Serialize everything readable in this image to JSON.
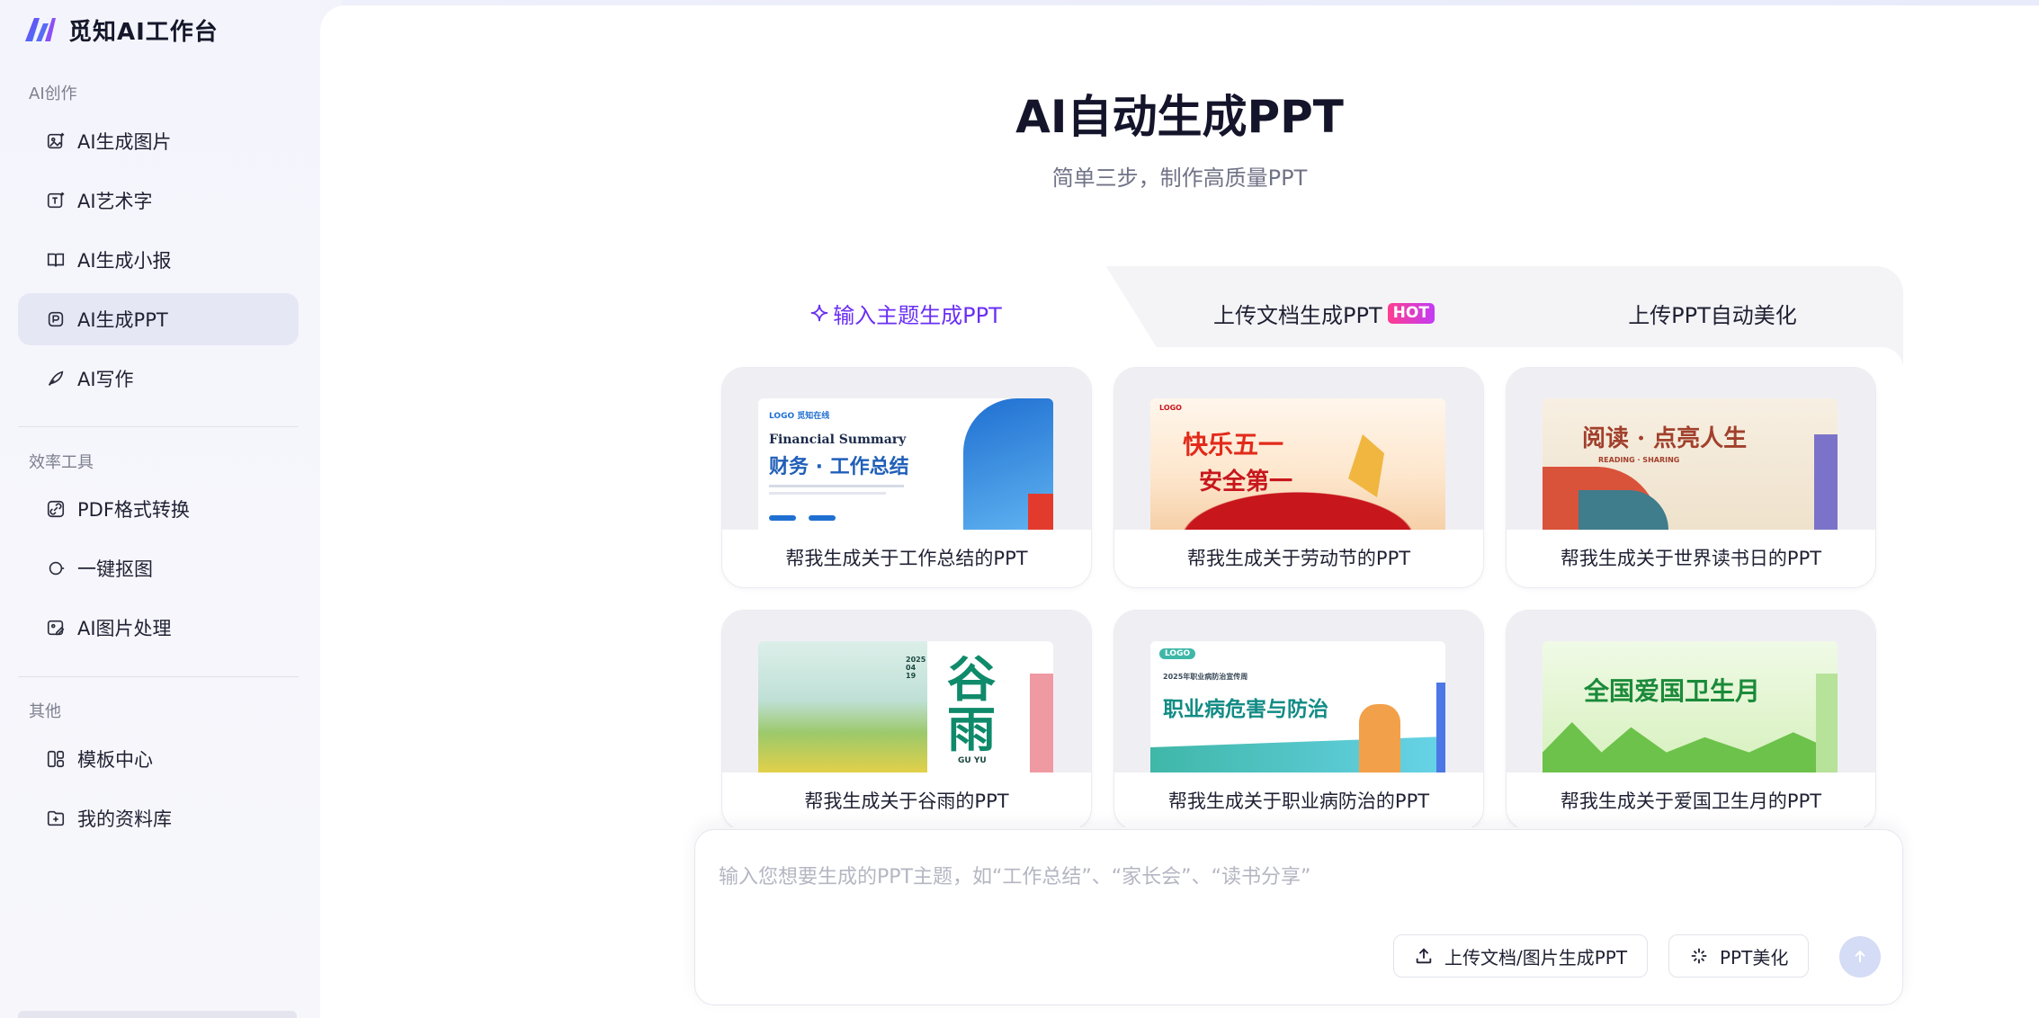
{
  "brand": {
    "name": "觅知AI工作台"
  },
  "sidebar": {
    "sections": [
      {
        "title": "AI创作"
      },
      {
        "title": "效率工具"
      },
      {
        "title": "其他"
      }
    ],
    "items": [
      {
        "label": "AI生成图片",
        "icon": "image-sparkle-icon"
      },
      {
        "label": "AI艺术字",
        "icon": "text-sparkle-icon"
      },
      {
        "label": "AI生成小报",
        "icon": "book-icon"
      },
      {
        "label": "AI生成PPT",
        "icon": "ppt-icon",
        "active": true
      },
      {
        "label": "AI写作",
        "icon": "quill-icon"
      },
      {
        "label": "PDF格式转换",
        "icon": "link-convert-icon"
      },
      {
        "label": "一键抠图",
        "icon": "cutout-icon"
      },
      {
        "label": "AI图片处理",
        "icon": "image-edit-icon"
      },
      {
        "label": "模板中心",
        "icon": "template-icon"
      },
      {
        "label": "我的资料库",
        "icon": "folder-icon"
      }
    ]
  },
  "main": {
    "title": "AI自动生成PPT",
    "subtitle": "简单三步，制作高质量PPT",
    "tabs": [
      {
        "label": "输入主题生成PPT",
        "active": true
      },
      {
        "label": "上传文档生成PPT",
        "badge": "HOT"
      },
      {
        "label": "上传PPT自动美化"
      }
    ],
    "templates": [
      {
        "caption": "帮我生成关于工作总结的PPT",
        "thumb_title": "财务 · 工作总结",
        "thumb_sub": "Financial Summary",
        "thumb_logo": "LOGO 觅知在线"
      },
      {
        "caption": "帮我生成关于劳动节的PPT",
        "thumb_title": "快乐五一",
        "thumb_sub": "安全第一",
        "thumb_logo": "LOGO"
      },
      {
        "caption": "帮我生成关于世界读书日的PPT",
        "thumb_title": "阅读 · 点亮人生",
        "thumb_sub": "READING · SHARING"
      },
      {
        "caption": "帮我生成关于谷雨的PPT",
        "thumb_title": "谷雨",
        "thumb_sub": "GU YU",
        "thumb_date": "2025 04 19"
      },
      {
        "caption": "帮我生成关于职业病防治的PPT",
        "thumb_title": "职业病危害与防治",
        "thumb_sub": "2025年职业病防治宣传周",
        "thumb_logo": "LOGO"
      },
      {
        "caption": "帮我生成关于爱国卫生月的PPT",
        "thumb_title": "全国爱国卫生月"
      }
    ],
    "input": {
      "placeholder": "输入您想要生成的PPT主题，如“工作总结”、“家长会”、“读书分享”",
      "value": ""
    },
    "buttons": {
      "upload": "上传文档/图片生成PPT",
      "beautify": "PPT美化"
    }
  },
  "colors": {
    "accent": "#6a2ff5",
    "hot_badge": "#ff3c8e",
    "send_disabled": "#d5dcf5"
  }
}
